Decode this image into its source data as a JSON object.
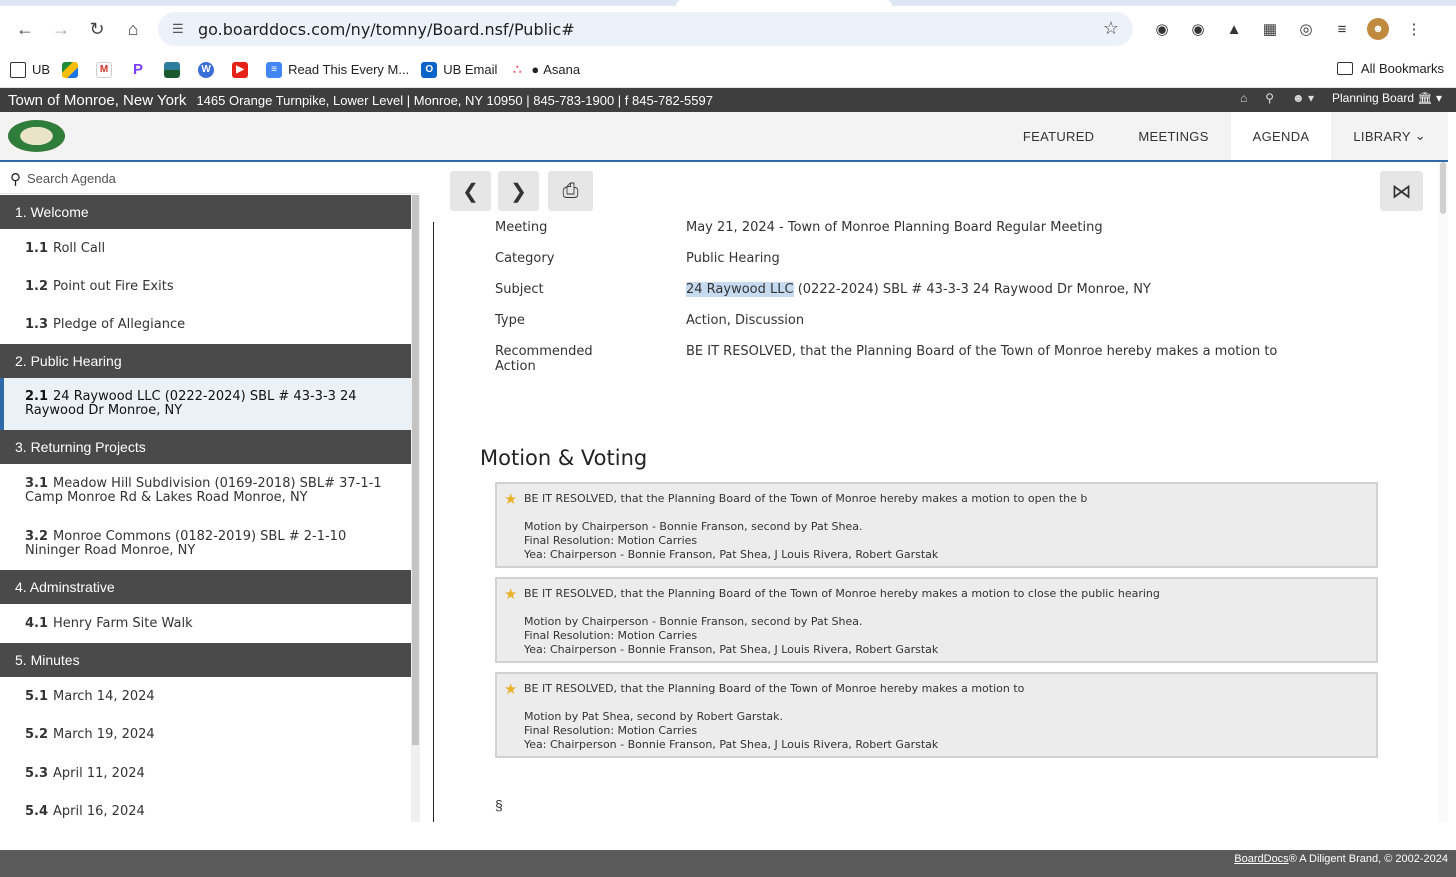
{
  "browser": {
    "url": "go.boarddocs.com/ny/tomny/Board.nsf/Public#",
    "bookmarks": [
      "UB",
      "",
      "",
      "",
      "",
      "",
      "",
      "Read This Every M...",
      "UB Email",
      "Asana"
    ],
    "all_bookmarks": "All Bookmarks"
  },
  "header": {
    "org_name": "Town of Monroe, New York",
    "address": "1465 Orange Turnpike, Lower Level | Monroe, NY 10950 | 845-783-1900 | f 845-782-5597",
    "board": "Planning Board"
  },
  "nav": {
    "tabs": [
      "FEATURED",
      "MEETINGS",
      "AGENDA",
      "LIBRARY"
    ],
    "active": "AGENDA"
  },
  "sidebar": {
    "search_placeholder": "Search Agenda",
    "categories": [
      {
        "label": "1. Welcome",
        "items": [
          {
            "num": "1.1",
            "text": "Roll Call"
          },
          {
            "num": "1.2",
            "text": "Point out Fire Exits"
          },
          {
            "num": "1.3",
            "text": "Pledge of Allegiance"
          }
        ]
      },
      {
        "label": "2. Public Hearing",
        "items": [
          {
            "num": "2.1",
            "text": "24 Raywood LLC (0222-2024) SBL # 43-3-3 24",
            "text2": "Raywood Dr Monroe, NY"
          }
        ]
      },
      {
        "label": "3. Returning Projects",
        "items": [
          {
            "num": "3.1",
            "text": "Meadow Hill Subdivision (0169-2018) SBL# 37-1-1",
            "text2": "Camp Monroe Rd & Lakes Road Monroe, NY"
          },
          {
            "num": "3.2",
            "text": "Monroe Commons (0182-2019) SBL # 2-1-10",
            "text2": "Nininger Road Monroe, NY"
          }
        ]
      },
      {
        "label": "4. Adminstrative",
        "items": [
          {
            "num": "4.1",
            "text": "Henry Farm Site Walk"
          }
        ]
      },
      {
        "label": "5. Minutes",
        "items": [
          {
            "num": "5.1",
            "text": "March 14, 2024"
          },
          {
            "num": "5.2",
            "text": "March 19, 2024"
          },
          {
            "num": "5.3",
            "text": "April 11, 2024"
          },
          {
            "num": "5.4",
            "text": "April 16, 2024"
          }
        ]
      }
    ]
  },
  "item": {
    "meeting_label": "Meeting",
    "meeting": "May 21, 2024 - Town of Monroe Planning Board Regular Meeting",
    "category_label": "Category",
    "category": "Public Hearing",
    "subject_label": "Subject",
    "subject_highlight": "24 Raywood LLC",
    "subject_rest": " (0222-2024) SBL # 43-3-3 24 Raywood Dr Monroe, NY",
    "type_label": "Type",
    "type": "Action, Discussion",
    "action_label": "Recommended Action",
    "action": "BE IT RESOLVED, that the Planning Board of the Town of Monroe hereby makes a motion to"
  },
  "motions": {
    "heading": "Motion & Voting",
    "list": [
      {
        "title": "BE IT RESOLVED, that the Planning Board of the Town of Monroe hereby makes a motion to open the b",
        "by": "Motion by Chairperson - Bonnie Franson, second by Pat Shea.",
        "result": "Final Resolution: Motion Carries",
        "yea": "Yea: Chairperson - Bonnie Franson, Pat Shea, J Louis Rivera, Robert Garstak"
      },
      {
        "title": "BE IT RESOLVED, that the Planning Board of the Town of Monroe hereby makes a motion to close the public hearing",
        "by": "Motion by Chairperson - Bonnie Franson, second by Pat Shea.",
        "result": "Final Resolution: Motion Carries",
        "yea": "Yea: Chairperson - Bonnie Franson, Pat Shea, J Louis Rivera, Robert Garstak"
      },
      {
        "title": "BE IT RESOLVED, that the Planning Board of the Town of Monroe hereby makes a motion to",
        "by": "Motion by Pat Shea, second by Robert Garstak.",
        "result": "Final Resolution: Motion Carries",
        "yea": "Yea: Chairperson - Bonnie Franson, Pat Shea, J Louis Rivera, Robert Garstak"
      }
    ],
    "section_mark": "§"
  },
  "footer": {
    "brand": "BoardDocs",
    "rest": "® A Diligent Brand, © 2002-2024"
  }
}
